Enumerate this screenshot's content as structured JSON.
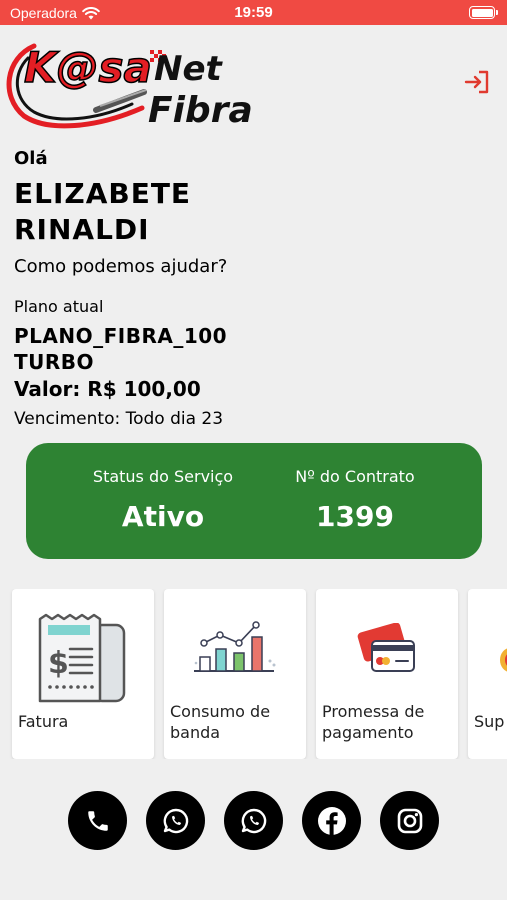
{
  "status_bar": {
    "carrier": "Operadora",
    "time": "19:59"
  },
  "logo": {
    "text_line1": "K@sa",
    "text_line1b": "Net",
    "text_line2": "Fibra"
  },
  "greeting": {
    "hello": "Olá",
    "name_line1": "ELIZABETE",
    "name_line2": "RINALDI",
    "help": "Como podemos ajudar?"
  },
  "plan": {
    "label": "Plano atual",
    "name_line1": "PLANO_FIBRA_100",
    "name_line2": "TURBO",
    "value": "Valor: R$ 100,00",
    "due": "Vencimento: Todo dia 23"
  },
  "status_card": {
    "status_label": "Status do Serviço",
    "status_value": "Ativo",
    "contract_label": "Nº do Contrato",
    "contract_value": "1399"
  },
  "tiles": [
    {
      "label_line1": "Fatura",
      "label_line2": "",
      "icon": "invoice-icon"
    },
    {
      "label_line1": "Consumo de",
      "label_line2": "banda",
      "icon": "bandwidth-chart-icon"
    },
    {
      "label_line1": "Promessa de",
      "label_line2": "pagamento",
      "icon": "credit-card-icon"
    },
    {
      "label_line1": "Sup",
      "label_line2": "",
      "icon": "support-icon"
    }
  ],
  "social": [
    "phone-icon",
    "whatsapp-icon",
    "whatsapp-icon",
    "facebook-icon",
    "instagram-icon"
  ],
  "colors": {
    "status_bar": "#f04a43",
    "card_green": "#2e8333",
    "logo_red": "#e31e24",
    "icon_red": "#e03a2f"
  }
}
